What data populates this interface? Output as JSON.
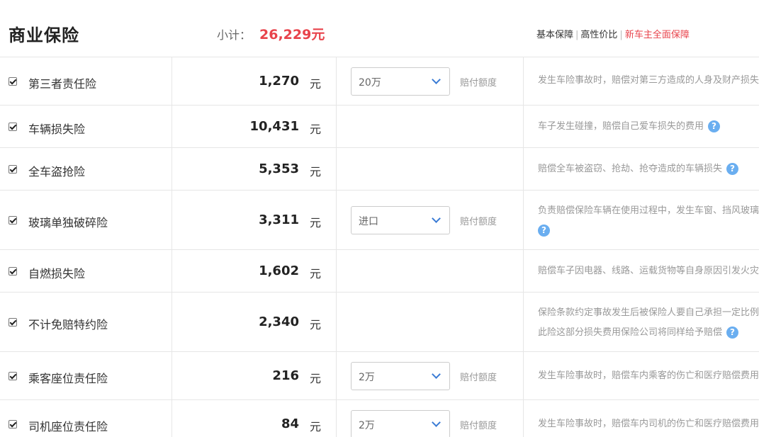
{
  "header": {
    "title": "商业保险",
    "subtotal_label": "小计：",
    "subtotal_value": "26,229元",
    "tabs": [
      "基本保障",
      "高性价比",
      "新车主全面保障"
    ],
    "active_tab": "新车主全面保障"
  },
  "colors": {
    "accent_red": "#e8434b",
    "help_blue": "#6aaef0",
    "chevron_blue": "#3a7bd5"
  },
  "rows": [
    {
      "name": "第三者责任险",
      "amount": "1,270",
      "unit": "元",
      "select_value": "20万",
      "select_label": "赔付额度",
      "desc": [
        "发生车险事故时，赔偿对第三方造成的人身及财产损失"
      ],
      "checked": true
    },
    {
      "name": "车辆损失险",
      "amount": "10,431",
      "unit": "元",
      "desc": [
        "车子发生碰撞，赔偿自己爱车损失的费用"
      ],
      "help": "?",
      "checked": true
    },
    {
      "name": "全车盗抢险",
      "amount": "5,353",
      "unit": "元",
      "desc": [
        "赔偿全车被盗窃、抢劫、抢夺造成的车辆损失"
      ],
      "help": "?",
      "checked": true
    },
    {
      "name": "玻璃单独破碎险",
      "amount": "3,311",
      "unit": "元",
      "select_value": "进口",
      "select_label": "赔付额度",
      "desc": [
        "负责赔偿保险车辆在使用过程中，发生车窗、挡风玻璃"
      ],
      "help": "?",
      "checked": true
    },
    {
      "name": "自燃损失险",
      "amount": "1,602",
      "unit": "元",
      "desc": [
        "赔偿车子因电器、线路、运载货物等自身原因引发火灾"
      ],
      "checked": true
    },
    {
      "name": "不计免赔特约险",
      "amount": "2,340",
      "unit": "元",
      "desc": [
        "保险条款约定事故发生后被保险人要自己承担一定比例",
        "此险这部分损失费用保险公司将同样给予赔偿"
      ],
      "help": "?",
      "checked": true
    },
    {
      "name": "乘客座位责任险",
      "amount": "216",
      "unit": "元",
      "select_value": "2万",
      "select_label": "赔付额度",
      "desc": [
        "发生车险事故时，赔偿车内乘客的伤亡和医疗赔偿费用"
      ],
      "checked": true
    },
    {
      "name": "司机座位责任险",
      "amount": "84",
      "unit": "元",
      "select_value": "2万",
      "select_label": "赔付额度",
      "desc": [
        "发生车险事故时，赔偿车内司机的伤亡和医疗赔偿费用"
      ],
      "checked": true
    }
  ]
}
